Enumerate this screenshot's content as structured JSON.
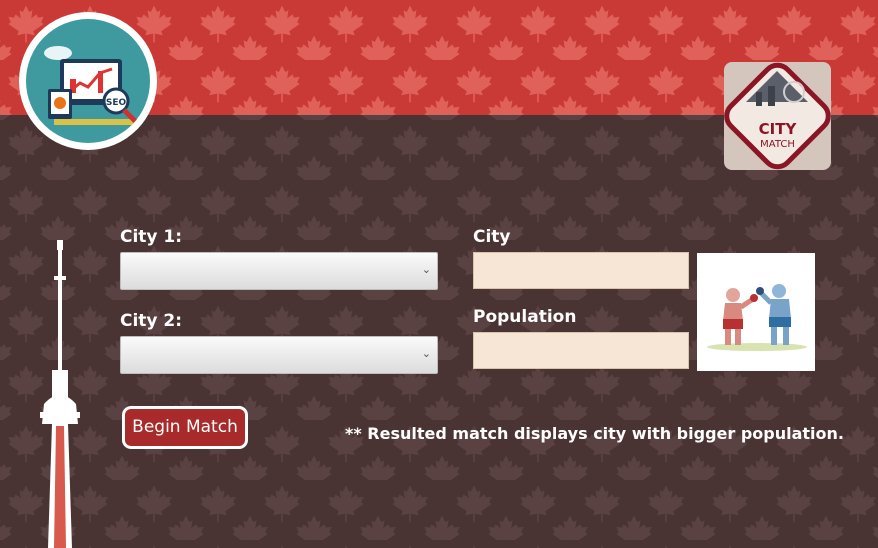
{
  "colors": {
    "header_red": "#c93a36",
    "body_brown": "#4a3333",
    "accent_red": "#a82a2a",
    "field_bg": "#f7e6d6"
  },
  "logo": {
    "icon": "seo-analytics-icon",
    "text": "SEO"
  },
  "badge": {
    "title": "CITY",
    "subtitle": "MATCH"
  },
  "form": {
    "city1_label": "City 1:",
    "city1_value": "",
    "city2_label": "City 2:",
    "city2_value": "",
    "city_label": "City",
    "city_value": "",
    "population_label": "Population",
    "population_value": ""
  },
  "begin_button": "Begin Match",
  "note": "** Resulted match displays city with bigger population.",
  "icons": {
    "boxing": "boxing-match-icon",
    "tower": "cn-tower-icon",
    "maple": "maple-leaf-icon"
  }
}
